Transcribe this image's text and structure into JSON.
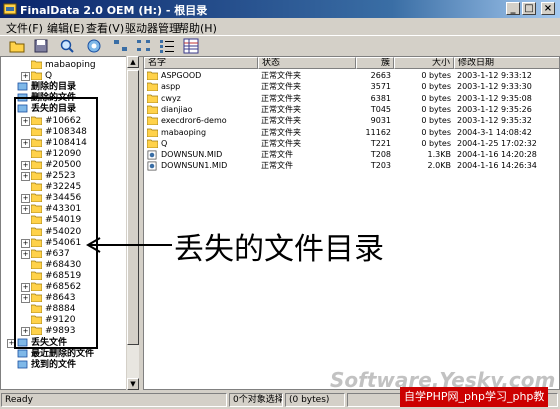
{
  "window": {
    "title": "FinalData 2.0 OEM (H:) - 根目录"
  },
  "menu": [
    "文件(F)",
    "编辑(E)",
    "查看(V)",
    "驱动器管理",
    "帮助(H)"
  ],
  "tree": {
    "items": [
      {
        "label": "mabaoping",
        "expand": false,
        "bold": false,
        "kind": "folder"
      },
      {
        "label": "Q",
        "expand": true,
        "bold": false,
        "kind": "folder"
      },
      {
        "label": "删除的目录",
        "expand": false,
        "bold": true,
        "kind": "special"
      },
      {
        "label": "删除的文件",
        "expand": false,
        "bold": true,
        "kind": "special"
      },
      {
        "label": "丢失的目录",
        "expand": false,
        "bold": true,
        "kind": "special"
      },
      {
        "label": "#10662",
        "expand": true,
        "bold": false,
        "kind": "folder"
      },
      {
        "label": "#108348",
        "expand": false,
        "bold": false,
        "kind": "folder"
      },
      {
        "label": "#108414",
        "expand": true,
        "bold": false,
        "kind": "folder"
      },
      {
        "label": "#12090",
        "expand": false,
        "bold": false,
        "kind": "folder"
      },
      {
        "label": "#20500",
        "expand": true,
        "bold": false,
        "kind": "folder"
      },
      {
        "label": "#2523",
        "expand": true,
        "bold": false,
        "kind": "folder"
      },
      {
        "label": "#32245",
        "expand": false,
        "bold": false,
        "kind": "folder"
      },
      {
        "label": "#34456",
        "expand": true,
        "bold": false,
        "kind": "folder"
      },
      {
        "label": "#43301",
        "expand": true,
        "bold": false,
        "kind": "folder"
      },
      {
        "label": "#54019",
        "expand": false,
        "bold": false,
        "kind": "folder"
      },
      {
        "label": "#54020",
        "expand": false,
        "bold": false,
        "kind": "folder"
      },
      {
        "label": "#54061",
        "expand": true,
        "bold": false,
        "kind": "folder"
      },
      {
        "label": "#637",
        "expand": true,
        "bold": false,
        "kind": "folder"
      },
      {
        "label": "#68430",
        "expand": false,
        "bold": false,
        "kind": "folder"
      },
      {
        "label": "#68519",
        "expand": false,
        "bold": false,
        "kind": "folder"
      },
      {
        "label": "#68562",
        "expand": true,
        "bold": false,
        "kind": "folder"
      },
      {
        "label": "#8643",
        "expand": true,
        "bold": false,
        "kind": "folder"
      },
      {
        "label": "#8884",
        "expand": false,
        "bold": false,
        "kind": "folder"
      },
      {
        "label": "#9120",
        "expand": false,
        "bold": false,
        "kind": "folder"
      },
      {
        "label": "#9893",
        "expand": true,
        "bold": false,
        "kind": "folder"
      },
      {
        "label": "丢失文件",
        "expand": true,
        "bold": true,
        "kind": "special"
      },
      {
        "label": "最近删除的文件",
        "expand": false,
        "bold": true,
        "kind": "special"
      },
      {
        "label": "找到的文件",
        "expand": false,
        "bold": true,
        "kind": "special"
      }
    ]
  },
  "list": {
    "columns": [
      "名字",
      "状态",
      "簇",
      "大小",
      "修改日期"
    ],
    "rows": [
      {
        "name": "ASPGOOD",
        "status": "正常文件夹",
        "cluster": "2663",
        "size": "0 bytes",
        "date": "2003-1-12 9:33:12",
        "kind": "folder"
      },
      {
        "name": "aspp",
        "status": "正常文件夹",
        "cluster": "3571",
        "size": "0 bytes",
        "date": "2003-1-12 9:33:30",
        "kind": "folder"
      },
      {
        "name": "cwyz",
        "status": "正常文件夹",
        "cluster": "6381",
        "size": "0 bytes",
        "date": "2003-1-12 9:35:08",
        "kind": "folder"
      },
      {
        "name": "dianjiao",
        "status": "正常文件夹",
        "cluster": "T045",
        "size": "0 bytes",
        "date": "2003-1-12 9:35:26",
        "kind": "folder"
      },
      {
        "name": "execdror6-demo",
        "status": "正常文件夹",
        "cluster": "9031",
        "size": "0 bytes",
        "date": "2003-1-12 9:35:32",
        "kind": "folder"
      },
      {
        "name": "mabaoping",
        "status": "正常文件夹",
        "cluster": "11162",
        "size": "0 bytes",
        "date": "2004-3-1 14:08:42",
        "kind": "folder"
      },
      {
        "name": "Q",
        "status": "正常文件夹",
        "cluster": "T221",
        "size": "0 bytes",
        "date": "2004-1-25 17:02:32",
        "kind": "folder"
      },
      {
        "name": "DOWNSUN.MID",
        "status": "正常文件",
        "cluster": "T208",
        "size": "1.3KB",
        "date": "2004-1-16 14:20:28",
        "kind": "file"
      },
      {
        "name": "DOWNSUN1.MID",
        "status": "正常文件",
        "cluster": "T203",
        "size": "2.0KB",
        "date": "2004-1-16 14:26:34",
        "kind": "file"
      }
    ]
  },
  "status": {
    "left": "Ready",
    "selection": "0个对象选择",
    "bytes": "(0 bytes)"
  },
  "annotation": "丢失的文件目录",
  "watermark": {
    "site": "Software.Yesky.com",
    "badge": "自学PHP网_php学习_php教"
  }
}
